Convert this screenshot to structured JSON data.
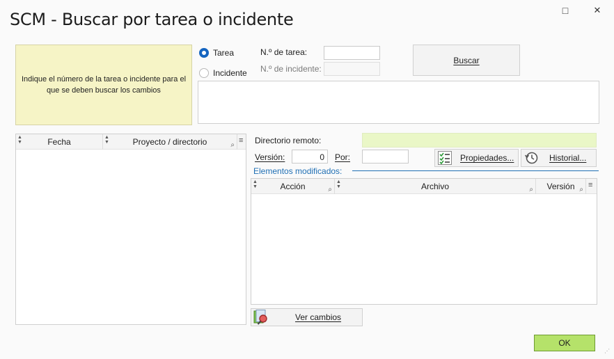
{
  "window": {
    "title": "SCM - Buscar por tarea o incidente",
    "maximize_icon": "□",
    "close_icon": "✕"
  },
  "help": {
    "text": "Indique el número de la tarea o incidente para el que se deben buscar los cambios"
  },
  "search": {
    "option_task": "Tarea",
    "option_incident": "Incidente",
    "selected": "Tarea",
    "task_number_label": "N.º de tarea:",
    "task_number_value": "",
    "incident_number_label": "N.º de incidente:",
    "incident_number_value": "",
    "search_button": "Buscar"
  },
  "projects_grid": {
    "columns": [
      "Fecha",
      "Proyecto / directorio"
    ],
    "rows": []
  },
  "details": {
    "remote_dir_label": "Directorio remoto:",
    "remote_dir_value": "",
    "version_label": "Versión:",
    "version_value": "0",
    "by_label": "Por:",
    "by_value": "",
    "properties_button": "Propiedades...",
    "history_button": "Historial...",
    "modified_label": "Elementos modificados:"
  },
  "modified_grid": {
    "columns": [
      "Acción",
      "Archivo",
      "Versión"
    ],
    "rows": []
  },
  "actions": {
    "view_changes_button": "Ver cambios",
    "ok_button": "OK"
  },
  "colors": {
    "help_bg": "#f6f4c6",
    "remote_dir_bg": "#eaf7c7",
    "ok_bg": "#b5e26a",
    "accent_blue": "#1f6fb4"
  }
}
